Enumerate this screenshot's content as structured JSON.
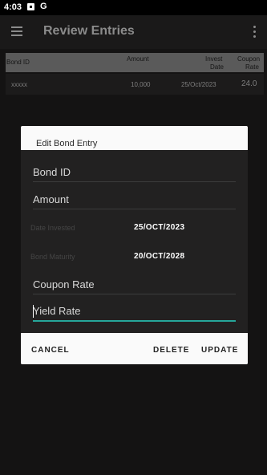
{
  "status_bar": {
    "time": "4:03",
    "g_icon": "G"
  },
  "app_bar": {
    "title": "Review Entries"
  },
  "table": {
    "headers": {
      "bond_id": "Bond ID",
      "amount": "Amount",
      "invest_date_line1": "Invest",
      "invest_date_line2": "Date",
      "coupon_rate_line1": "Coupon",
      "coupon_rate_line2": "Rate"
    },
    "rows": [
      {
        "bond_id": "xxxxx",
        "amount": "10,000",
        "invest_date": "25/Oct/2023",
        "coupon_rate": "24.0"
      }
    ]
  },
  "dialog": {
    "title": "Edit Bond Entry",
    "fields": {
      "bond_id": {
        "placeholder": "Bond ID"
      },
      "amount": {
        "placeholder": "Amount"
      },
      "date_invested": {
        "label": "Date Invested",
        "value": "25/OCT/2023"
      },
      "bond_maturity": {
        "label": "Bond Maturity",
        "value": "20/OCT/2028"
      },
      "coupon_rate": {
        "placeholder": "Coupon Rate"
      },
      "yield_rate": {
        "placeholder": "Yield Rate"
      }
    },
    "actions": {
      "cancel": "CANCEL",
      "delete": "DELETE",
      "update": "UPDATE"
    }
  },
  "colors": {
    "accent": "#26a69a",
    "scrim": "#141313",
    "dialog_surface": "#222121"
  }
}
